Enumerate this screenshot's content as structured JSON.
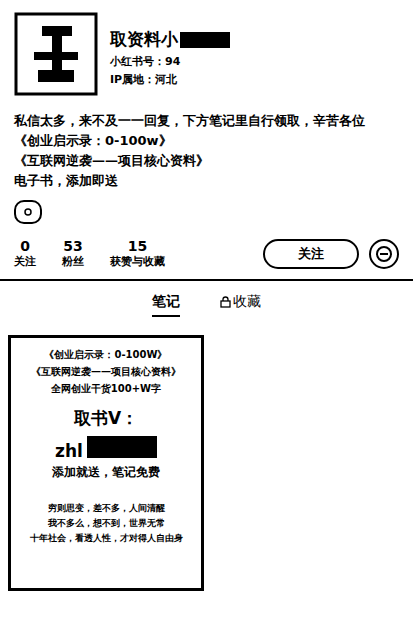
{
  "profile": {
    "name": "取资料小",
    "id_line": "小红书号：94",
    "ip_line": "IP属地：河北",
    "bio": [
      "私信太多，来不及一一回复，下方笔记里自行领取，辛苦各位",
      "《创业启示录：0-100w》",
      "《互联网逆袭——项目核心资料》",
      "电子书，添加即送"
    ]
  },
  "stats": [
    {
      "value": "0",
      "label": "关注"
    },
    {
      "value": "53",
      "label": "粉丝"
    },
    {
      "value": "15",
      "label": "获赞与收藏"
    }
  ],
  "follow_button": "关注",
  "tabs": [
    {
      "label": "笔记",
      "selected": true,
      "locked": false
    },
    {
      "label": "收藏",
      "selected": false,
      "locked": true
    }
  ],
  "notes": [
    {
      "lines_top": [
        "《创业启示录：0-100W》",
        "《互联网逆袭——项目核心资料》",
        "全网创业干货100+W字"
      ],
      "headline": "取书V：",
      "code": "zhl",
      "cta": "添加就送，笔记免费",
      "lines_bottom": [
        "穷则思变，差不多，人间清醒",
        "我不多么，想不到，世界无常",
        "十年社会，看透人性，才对得人自由身"
      ]
    }
  ]
}
